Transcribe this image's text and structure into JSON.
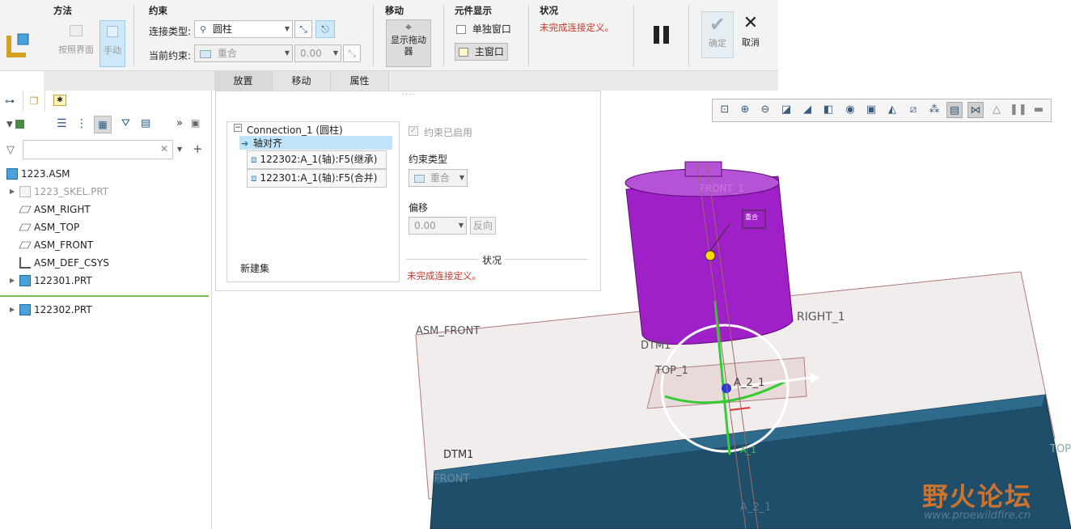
{
  "ribbon": {
    "method": {
      "title": "方法",
      "ref_ui_label": "按照界面",
      "manual_label": "手动"
    },
    "constraint": {
      "title": "约束",
      "connection_type_label": "连接类型:",
      "connection_type_value": "圆柱",
      "current_constraint_label": "当前约束:",
      "current_constraint_value": "重合",
      "offset_value": "0.00"
    },
    "move": {
      "title": "移动",
      "show_dragger_label": "显示拖动器"
    },
    "component_display": {
      "title": "元件显示",
      "separate_window_label": "单独窗口",
      "main_window_label": "主窗口"
    },
    "status": {
      "title": "状况",
      "text": "未完成连接定义。"
    },
    "ok_label": "确定",
    "cancel_label": "取消"
  },
  "tabs": [
    {
      "label": "放置",
      "active": true
    },
    {
      "label": "移动",
      "active": false
    },
    {
      "label": "属性",
      "active": false
    }
  ],
  "tree": {
    "items": [
      {
        "label": "1223.ASM",
        "icon": "assembly-icon",
        "expand": false,
        "muted": false
      },
      {
        "label": "1223_SKEL.PRT",
        "icon": "skeleton-part-icon",
        "expand": true,
        "muted": true
      },
      {
        "label": "ASM_RIGHT",
        "icon": "datum-plane-icon",
        "expand": false,
        "muted": false
      },
      {
        "label": "ASM_TOP",
        "icon": "datum-plane-icon",
        "expand": false,
        "muted": false
      },
      {
        "label": "ASM_FRONT",
        "icon": "datum-plane-icon",
        "expand": false,
        "muted": false
      },
      {
        "label": "ASM_DEF_CSYS",
        "icon": "csys-icon",
        "expand": false,
        "muted": false
      },
      {
        "label": "122301.PRT",
        "icon": "part-icon",
        "expand": true,
        "muted": false
      },
      {
        "label": "122302.PRT",
        "icon": "part-icon",
        "expand": true,
        "muted": false
      }
    ]
  },
  "placement_panel": {
    "connection_label": "Connection_1 (圆柱)",
    "constraint_item": "轴对齐",
    "ref1": "122302:A_1(轴):F5(继承)",
    "ref2": "122301:A_1(轴):F5(合并)",
    "new_set_label": "新建集",
    "constraint_enabled_label": "约束已启用",
    "constraint_type_label": "约束类型",
    "constraint_type_value": "重合",
    "offset_label": "偏移",
    "offset_value": "0.00",
    "reverse_label": "反向",
    "status_label": "状况",
    "status_text": "未完成连接定义。"
  },
  "viewport": {
    "labels": {
      "asm_front": "ASM_FRONT",
      "right_1": "RIGHT_1",
      "dtm1_top": "DTM1",
      "top_1": "TOP_1",
      "axis_a2_1": "A_2_1",
      "dtm1_bottom": "DTM1",
      "front": "FRONT",
      "top_right": "TOP",
      "a_2_1_bottom": "A_2_1",
      "a_1_lower": "A_1",
      "coincide_tag": "重合",
      "front_top": "FRONT_1"
    }
  },
  "watermark": {
    "brand": "野火论坛",
    "url": "www.proewildfire.cn"
  },
  "colors": {
    "purple_part": "#a020c8",
    "blue_part": "#1f4e6b",
    "status_red": "#c0392b",
    "highlight_blue": "#bfe3f7"
  }
}
